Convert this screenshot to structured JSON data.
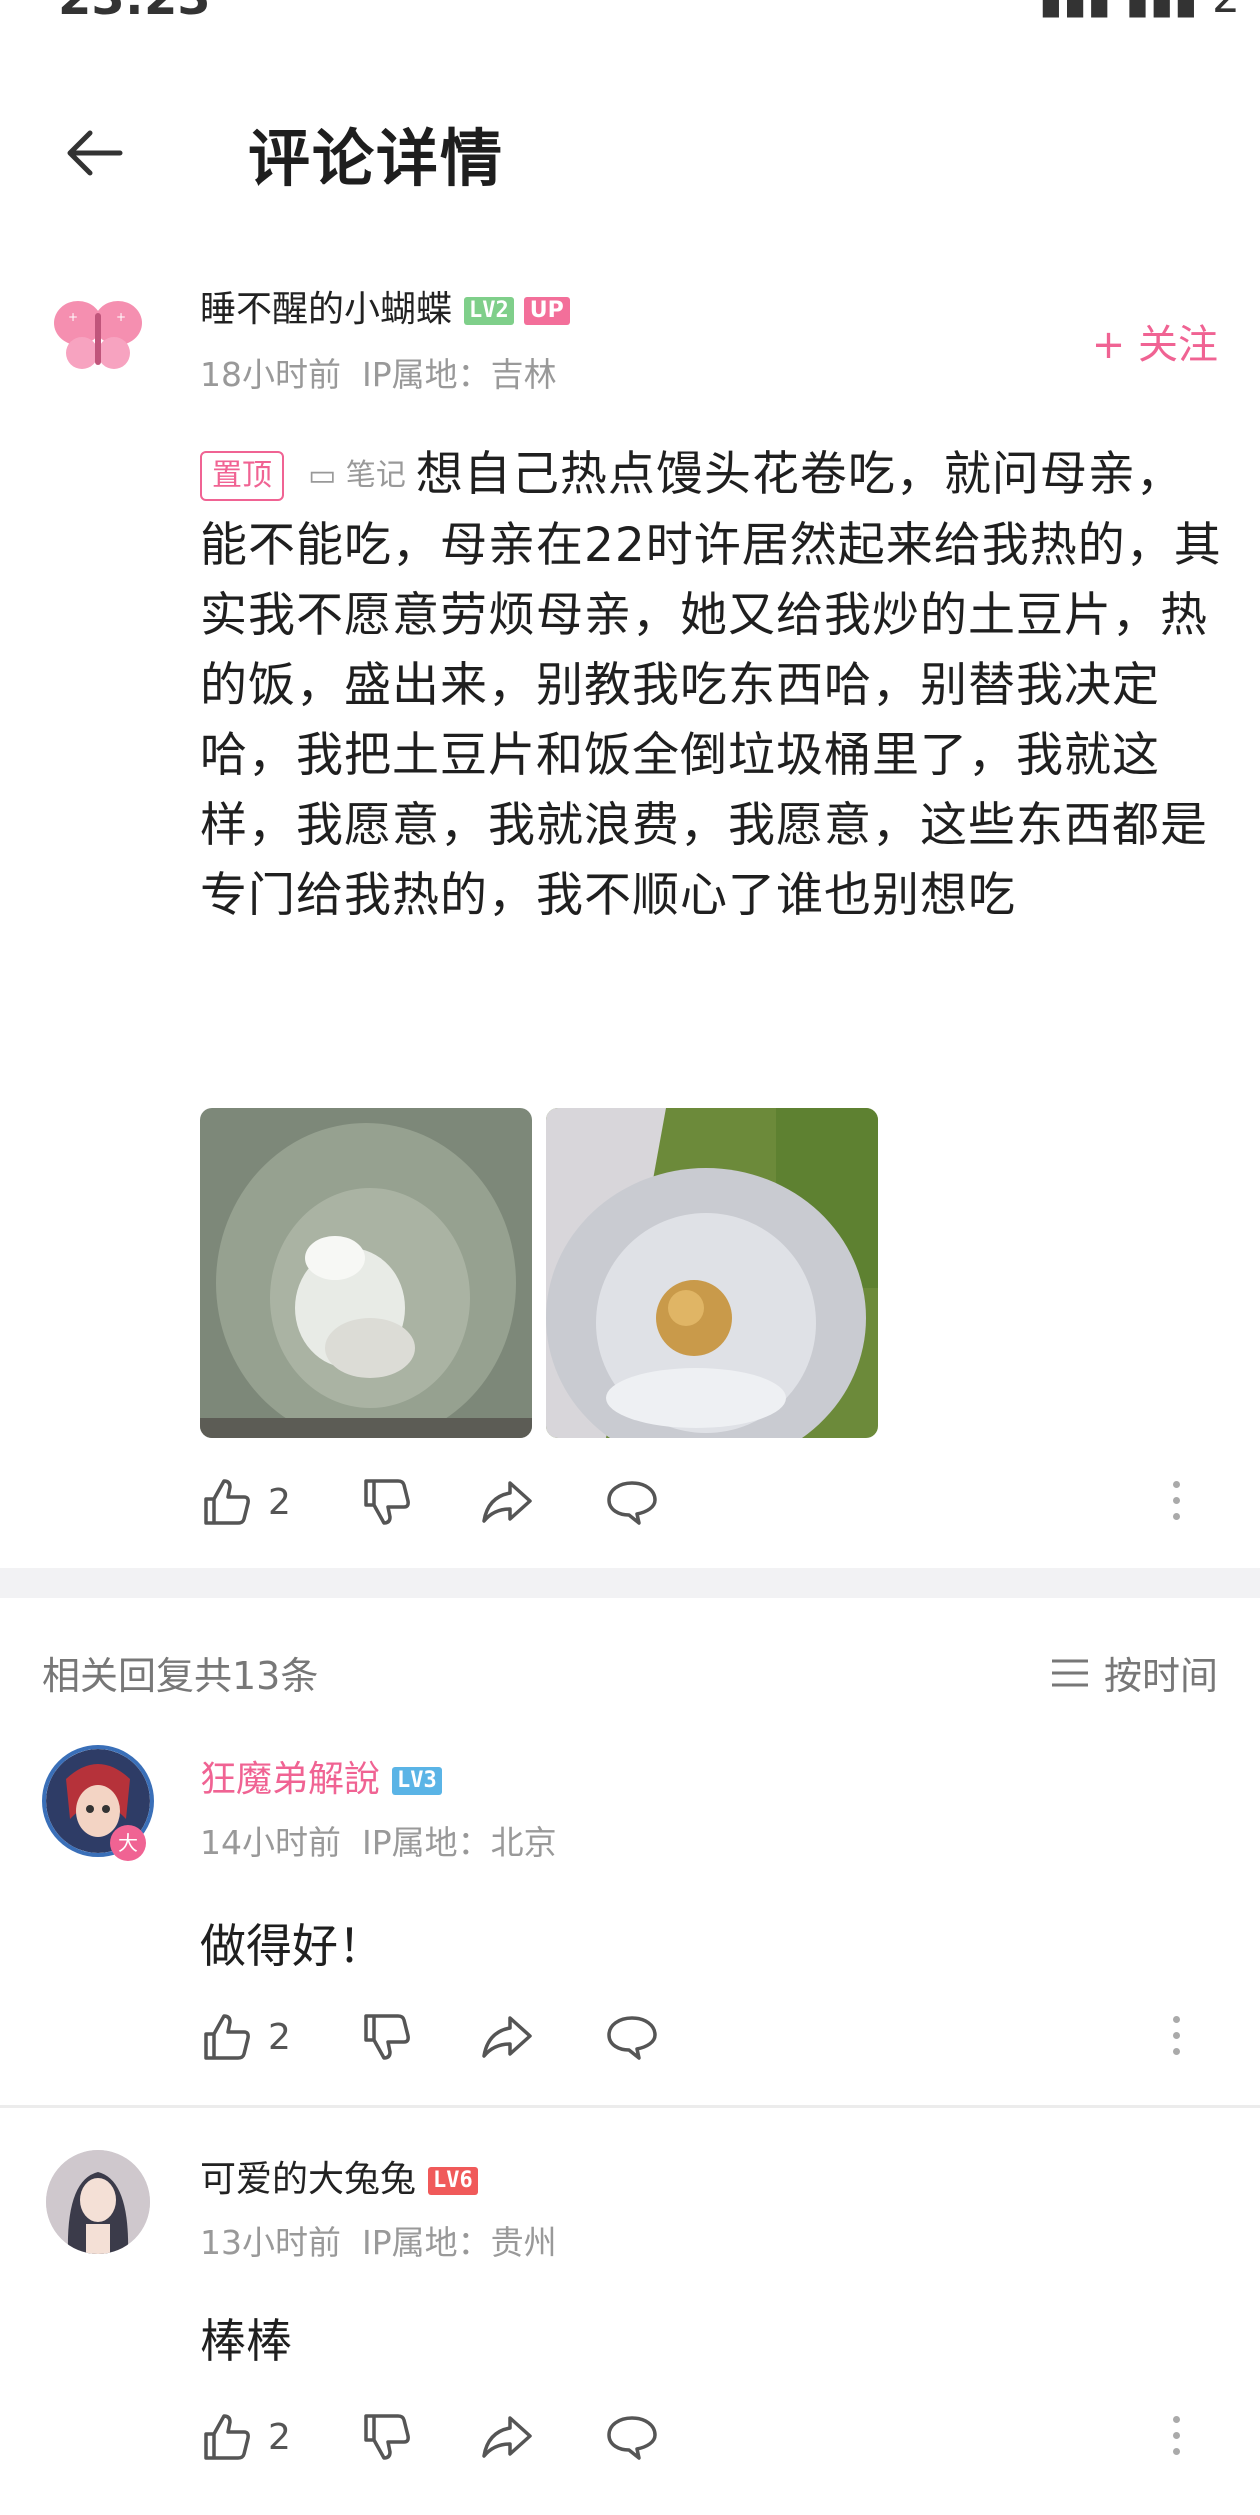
{
  "status": {
    "time": "23:23",
    "battery": "2"
  },
  "header": {
    "title": "评论详情"
  },
  "main_comment": {
    "username": "睡不醒的小蝴蝶",
    "level": "LV2",
    "up_badge": "UP",
    "time": "18小时前",
    "ip_location": "IP属地：吉林",
    "follow_label": "+ 关注",
    "pin_label": "置顶",
    "note_label": "笔记",
    "text": "想自己热点馒头花卷吃，就问母亲，能不能吃，母亲在22时许居然起来给我热的，其实我不愿意劳烦母亲，她又给我炒的土豆片，热的饭，盛出来，别教我吃东西哈，别替我决定哈，我把土豆片和饭全倒垃圾桶里了，我就这样，我愿意，我就浪费，我愿意，这些东西都是专门给我热的，我不顺心了谁也别想吃",
    "likes": "2"
  },
  "replies_header": {
    "count_label": "相关回复共13条",
    "sort_label": "按时间"
  },
  "replies": [
    {
      "username": "狂魔弟解說",
      "level": "LV3",
      "time": "14小时前",
      "ip_location": "IP属地：北京",
      "text": "做得好！",
      "likes": "2"
    },
    {
      "username": "可爱的大兔兔",
      "level": "LV6",
      "time": "13小时前",
      "ip_location": "IP属地：贵州",
      "text": "棒棒",
      "likes": "2"
    }
  ],
  "colors": {
    "accent": "#f06393",
    "lv2": "#7fcf8a",
    "lv3": "#5ab4e6",
    "lv6": "#f05a5a"
  }
}
